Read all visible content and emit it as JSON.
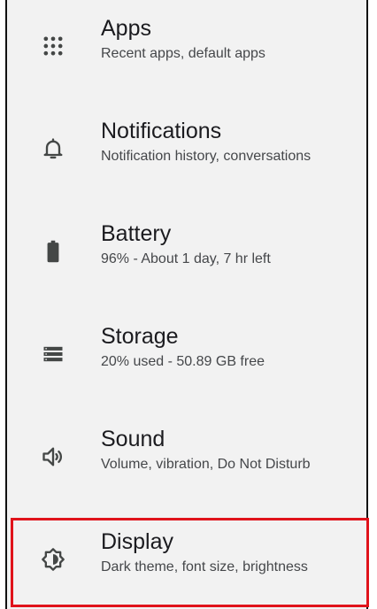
{
  "settings": {
    "items": [
      {
        "icon": "apps-grid-icon",
        "title": "Apps",
        "subtitle": "Recent apps, default apps"
      },
      {
        "icon": "notification-bell-icon",
        "title": "Notifications",
        "subtitle": "Notification history, conversations"
      },
      {
        "icon": "battery-icon",
        "title": "Battery",
        "subtitle": "96% - About 1 day, 7 hr left"
      },
      {
        "icon": "storage-icon",
        "title": "Storage",
        "subtitle": "20% used - 50.89 GB free"
      },
      {
        "icon": "volume-icon",
        "title": "Sound",
        "subtitle": "Volume, vibration, Do Not Disturb"
      },
      {
        "icon": "display-brightness-icon",
        "title": "Display",
        "subtitle": "Dark theme, font size, brightness"
      }
    ]
  },
  "colors": {
    "background": "#f2f2f2",
    "icon": "#444746",
    "title": "#1b1b1f",
    "subtitle": "#45474a",
    "highlight_border": "#e0131b"
  }
}
